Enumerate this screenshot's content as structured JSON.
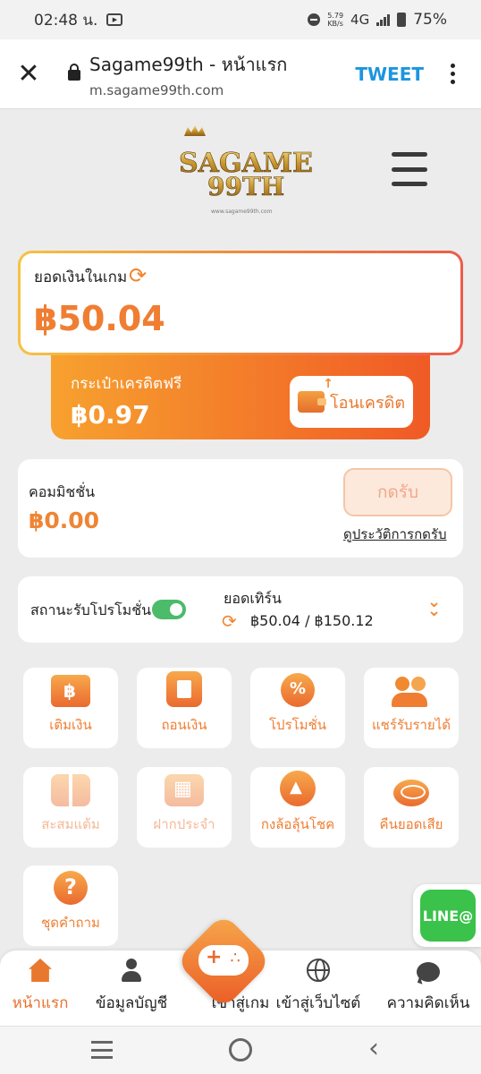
{
  "status_bar": {
    "time": "02:48 น.",
    "speed_top": "5.79",
    "speed_bottom": "KB/s",
    "network": "4G",
    "battery": "75%"
  },
  "browser": {
    "title": "Sagame99th - หน้าแรก",
    "url": "m.sagame99th.com",
    "tweet_label": "TWEET"
  },
  "header": {
    "logo_text_top": "SAGAME",
    "logo_text_bottom": "99TH",
    "logo_small": "www.sagame99th.com"
  },
  "balance": {
    "label": "ยอดเงินในเกม",
    "value": "฿50.04"
  },
  "free_credit": {
    "label": "กระเป๋าเครดิตฟรี",
    "value": "฿0.97",
    "transfer_label": "โอนเครดิต"
  },
  "commission": {
    "label": "คอมมิชชั่น",
    "value": "฿0.00",
    "claim_label": "กดรับ",
    "history_label": "ดูประวัติการกดรับ"
  },
  "promotion": {
    "status_label": "สถานะรับโปรโมชั่น",
    "toggle_on": true,
    "turnover_label": "ยอดเทิร์น",
    "turnover_value": "฿50.04 / ฿150.12"
  },
  "menu": [
    {
      "label": "เติมเงิน",
      "icon": "deposit-icon"
    },
    {
      "label": "ถอนเงิน",
      "icon": "withdraw-icon"
    },
    {
      "label": "โปรโมชั่น",
      "icon": "promotion-icon"
    },
    {
      "label": "แชร์รับรายได้",
      "icon": "share-income-icon"
    },
    {
      "label": "สะสมแต้ม",
      "icon": "gift-icon"
    },
    {
      "label": "ฝากประจำ",
      "icon": "calendar-icon"
    },
    {
      "label": "กงล้อลุ้นโชค",
      "icon": "lucky-wheel-icon"
    },
    {
      "label": "คืนยอดเสีย",
      "icon": "coin-icon"
    },
    {
      "label": "ชุดคำถาม",
      "icon": "question-icon"
    }
  ],
  "line_label": "LINE@",
  "bottom_nav": [
    {
      "label": "หน้าแรก",
      "icon": "home-icon"
    },
    {
      "label": "ข้อมูลบัญชี",
      "icon": "user-icon"
    },
    {
      "label": "เข้าสู่เกม",
      "icon": "gamepad-icon"
    },
    {
      "label": "เข้าสู่เว็บไซต์",
      "icon": "globe-icon"
    },
    {
      "label": "ความคิดเห็น",
      "icon": "chat-icon"
    }
  ],
  "colors": {
    "accent": "#ef7e33",
    "accent_dark": "#ea5a25",
    "line_green": "#3ac24a",
    "toggle_green": "#4cbb6a",
    "tweet_blue": "#1c95e0"
  }
}
